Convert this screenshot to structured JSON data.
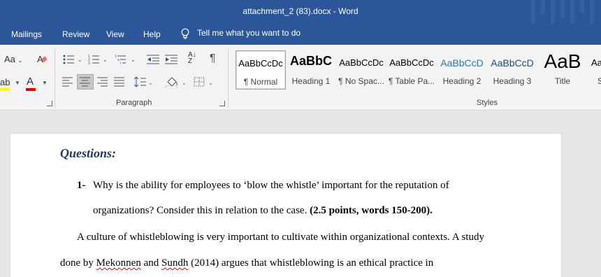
{
  "window": {
    "title": "attachment_2 (83).docx  -  Word"
  },
  "tabs": [
    {
      "label": "Mailings"
    },
    {
      "label": "Review"
    },
    {
      "label": "View"
    },
    {
      "label": "Help"
    }
  ],
  "tell_me": {
    "text": "Tell me what you want to do",
    "icon": "lightbulb-icon"
  },
  "ribbon": {
    "font_group": {
      "change_case_label": "Aa",
      "clear_format_icon": "clear-formatting-icon",
      "highlight_partial": "ab",
      "font_color_label": "A",
      "highlight_color": "#ffff00",
      "font_color": "#e00000"
    },
    "paragraph_group": {
      "label": "Paragraph",
      "pilcrow": "¶",
      "sort_label": "A↓Z"
    },
    "styles_group": {
      "label": "Styles",
      "items": [
        {
          "preview": "AaBbCcDc",
          "name": "¶ Normal",
          "color": "#000000",
          "active": true
        },
        {
          "preview": "AaBbC",
          "name": "Heading 1",
          "color": "#000000"
        },
        {
          "preview": "AaBbCcDc",
          "name": "¶ No Spac...",
          "color": "#000000"
        },
        {
          "preview": "AaBbCcDc",
          "name": "¶ Table Pa...",
          "color": "#000000"
        },
        {
          "preview": "AaBbCcD",
          "name": "Heading 2",
          "color": "#2e74b5"
        },
        {
          "preview": "AaBbCcD",
          "name": "Heading 3",
          "color": "#1f4e79"
        },
        {
          "preview": "AaB",
          "name": "Title",
          "color": "#000000"
        },
        {
          "preview": "Aa",
          "name": "S",
          "color": "#000000"
        }
      ]
    }
  },
  "document": {
    "heading": "Questions:",
    "question_number": "1-",
    "question_line1": "Why is the ability for employees to ‘blow the whistle’ important for the reputation of",
    "question_line2_regular": "organizations? Consider this in relation to the case.",
    "question_line2_bold": "(2.5 points, words 150-200).",
    "answer_line1": "A culture of whistleblowing is very important to cultivate within organizational contexts. A study",
    "answer_line2_a": "done by",
    "answer_line2_name1": "Mekonnen",
    "answer_line2_b": "and",
    "answer_line2_name2": "Sundh",
    "answer_line2_c": "(2014) argues that whistleblowing is an ethical practice in",
    "heading_color": "#1f3864"
  }
}
